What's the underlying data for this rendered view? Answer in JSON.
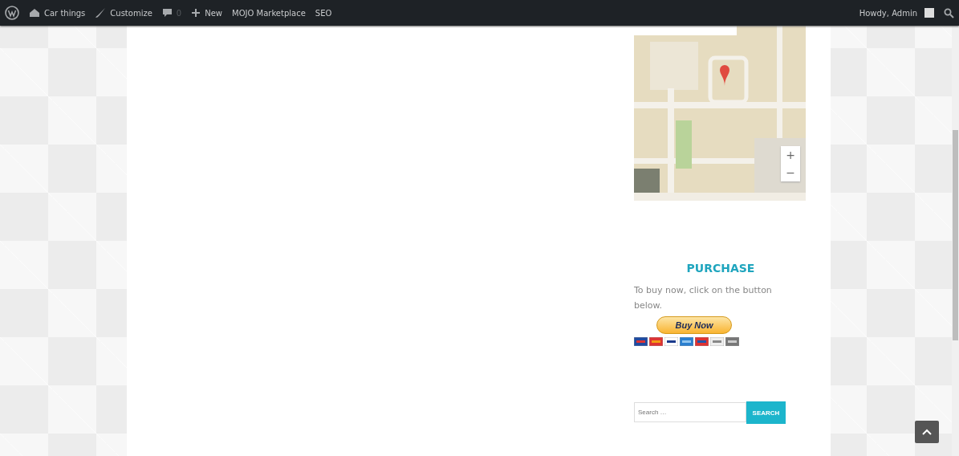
{
  "admin_bar": {
    "items": [
      {
        "kind": "logo"
      },
      {
        "kind": "home",
        "label": "Car things"
      },
      {
        "kind": "brush",
        "label": "Customize"
      },
      {
        "kind": "comments",
        "label": "0"
      },
      {
        "kind": "new",
        "label": "New"
      },
      {
        "kind": "text",
        "label": "MOJO Marketplace"
      },
      {
        "kind": "text",
        "label": "SEO"
      }
    ],
    "account": {
      "greeting": "Howdy, Admin"
    }
  },
  "sidebar": {
    "map": {
      "kind": "picture",
      "zoom_controls": [
        "+",
        "−"
      ]
    },
    "purchase": {
      "title": "PURCHASE",
      "text": "To buy now, click on the button below.",
      "button": "Buy Now"
    },
    "search": {
      "placeholder": "Search …",
      "button": "SEARCH"
    }
  }
}
